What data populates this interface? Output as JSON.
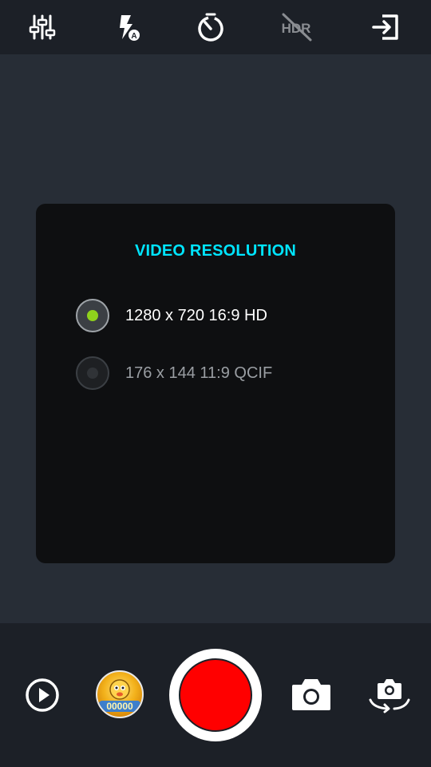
{
  "topbar": {
    "icons": {
      "settings": "sliders-icon",
      "flash": "flash-auto-icon",
      "timer": "timer-icon",
      "hdr": "hdr-off-icon",
      "exit": "exit-icon"
    },
    "hdr_text": "HDR"
  },
  "dialog": {
    "title": "VIDEO RESOLUTION",
    "options": [
      {
        "label": "1280 x 720 16:9 HD",
        "selected": true
      },
      {
        "label": "176 x 144 11:9 QCIF",
        "selected": false
      }
    ]
  },
  "bottombar": {
    "icons": {
      "play": "play-circle-icon",
      "gallery": "gallery-thumbnail",
      "record": "record-button",
      "photo": "camera-icon",
      "switch": "switch-camera-icon"
    },
    "thumbnail_text": "00000"
  },
  "colors": {
    "accent": "#00e5ff",
    "selected_dot": "#8fd11c",
    "record": "#ff0000",
    "background": "#272d36",
    "bars": "#1c2027",
    "dialog": "#0e0f11"
  }
}
